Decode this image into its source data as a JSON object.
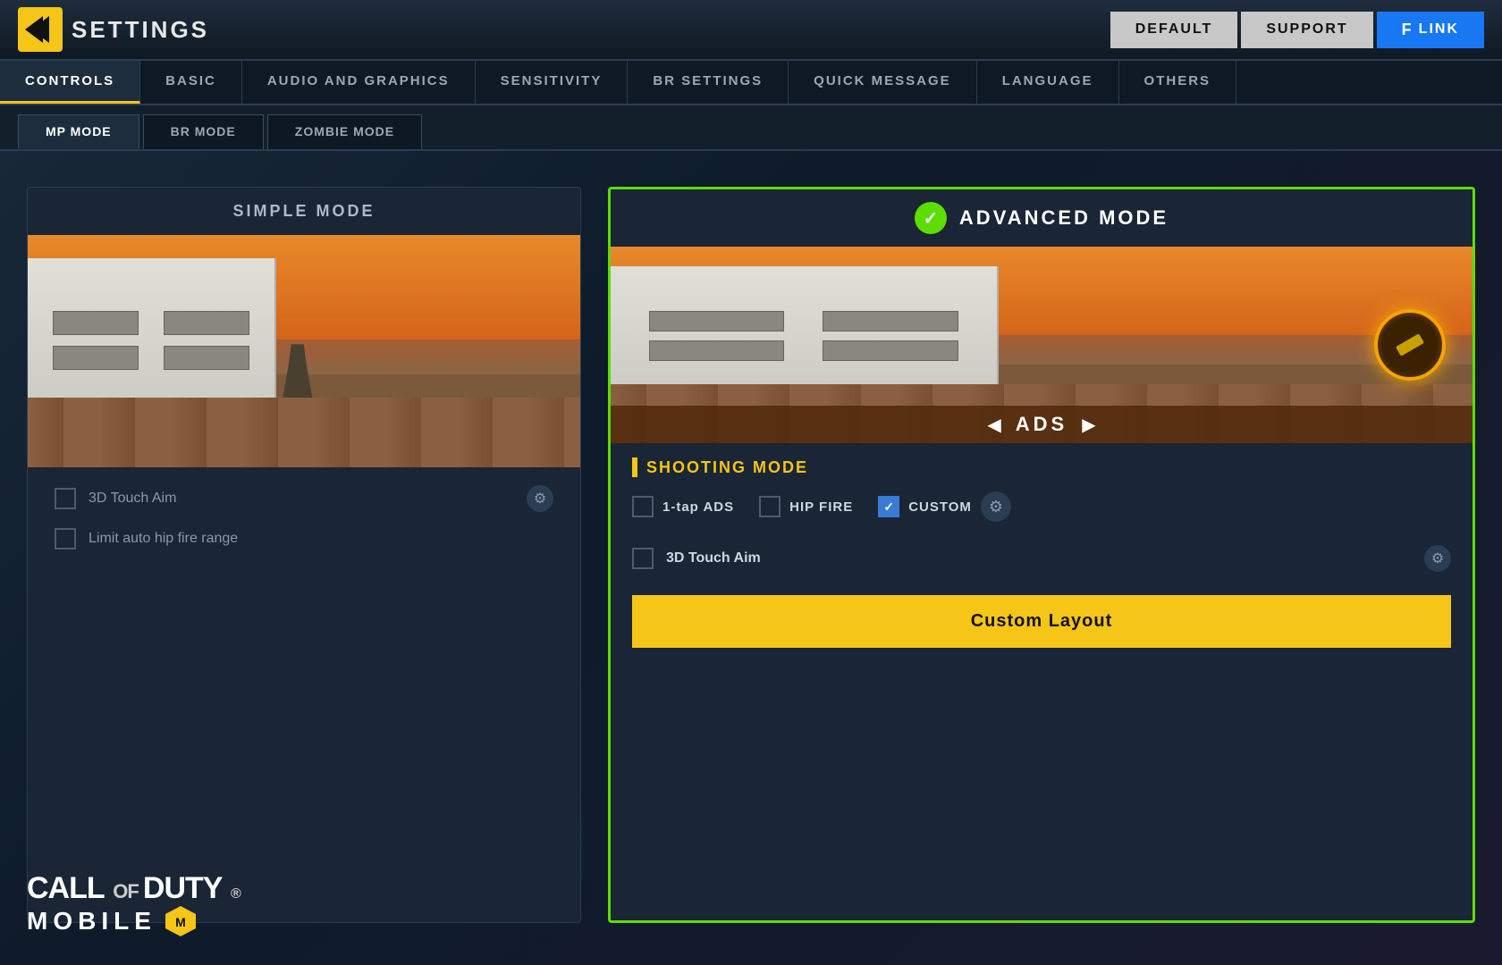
{
  "app": {
    "title": "SETTINGS",
    "logo_arrow": "❮❮"
  },
  "header": {
    "default_label": "DEFAULT",
    "support_label": "SUPPORT",
    "link_label": "LINK",
    "fb_icon": "f"
  },
  "main_tabs": [
    {
      "label": "CONTROLS",
      "active": true
    },
    {
      "label": "BASIC",
      "active": false
    },
    {
      "label": "AUDIO AND GRAPHICS",
      "active": false
    },
    {
      "label": "SENSITIVITY",
      "active": false
    },
    {
      "label": "BR SETTINGS",
      "active": false
    },
    {
      "label": "QUICK MESSAGE",
      "active": false
    },
    {
      "label": "LANGUAGE",
      "active": false
    },
    {
      "label": "OTHERS",
      "active": false
    }
  ],
  "sub_tabs": [
    {
      "label": "MP MODE",
      "active": true
    },
    {
      "label": "BR MODE",
      "active": false
    },
    {
      "label": "ZOMBIE MODE",
      "active": false
    }
  ],
  "simple_mode": {
    "title": "SIMPLE MODE",
    "option_3d_touch": "3D Touch Aim",
    "option_limit": "Limit auto hip fire range",
    "checked_3d": false,
    "checked_limit": false
  },
  "advanced_mode": {
    "title": "ADVANCED MODE",
    "check_icon": "✓",
    "ads_label": "ADS",
    "shooting_mode_label": "SHOOTING MODE",
    "opt_1tap": "1-tap ADS",
    "opt_hipfire": "HIP FIRE",
    "opt_custom": "CUSTOM",
    "opt_3d_touch": "3D Touch Aim",
    "custom_layout_btn": "Custom Layout",
    "custom_checked": true
  },
  "cod_logo": {
    "line1": "CALL OF DUTY.",
    "line2": "MOBILE",
    "registered": "®"
  },
  "colors": {
    "accent_green": "#5ddd00",
    "accent_yellow": "#f5c518",
    "accent_blue": "#3a7bd5",
    "header_bg": "#0f1923"
  }
}
